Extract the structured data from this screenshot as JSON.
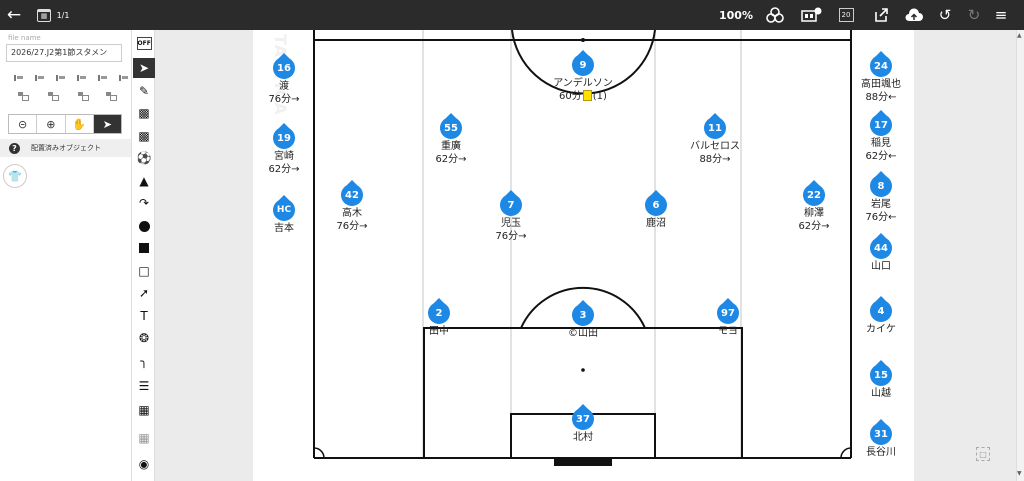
{
  "toolbar_top": {
    "page_count": "1/1",
    "zoom": "100%",
    "page_number_badge": "20",
    "icons": [
      "back-icon",
      "calendar-icon",
      "layers-icon",
      "settings-board-icon",
      "page-number-icon",
      "share-icon",
      "cloud-upload-icon",
      "undo-icon",
      "redo-icon",
      "menu-icon"
    ]
  },
  "left_panel": {
    "file_name_label": "file name",
    "file_name_value": "2026/27.J2第1節スタメン",
    "placed_objects_label": "配置済みオブジェクト"
  },
  "colors": {
    "player_marker": "#1e88e5",
    "yellow_card": "#ffe000",
    "topbar": "#2b2b2b"
  },
  "players": {
    "p16": {
      "number": "16",
      "name": "渡",
      "sub": "76分→"
    },
    "p19": {
      "number": "19",
      "name": "宮崎",
      "sub": "62分→"
    },
    "phc": {
      "number": "HC",
      "name": "吉本"
    },
    "p9": {
      "number": "9",
      "name": "アンデルソン",
      "sub_before": "60分",
      "sub_after": "(1)"
    },
    "p55": {
      "number": "55",
      "name": "重廣",
      "sub": "62分→"
    },
    "p11": {
      "number": "11",
      "name": "バルセロス",
      "sub": "88分→"
    },
    "p42": {
      "number": "42",
      "name": "高木",
      "sub": "76分→"
    },
    "p7": {
      "number": "7",
      "name": "児玉",
      "sub": "76分→"
    },
    "p6": {
      "number": "6",
      "name": "鹿沼"
    },
    "p22": {
      "number": "22",
      "name": "柳澤",
      "sub": "62分→"
    },
    "p2": {
      "number": "2",
      "name": "田中"
    },
    "p3": {
      "number": "3",
      "name": "©山田"
    },
    "p97": {
      "number": "97",
      "name": "モヨ"
    },
    "p37": {
      "number": "37",
      "name": "北村"
    },
    "p24": {
      "number": "24",
      "name": "高田颯也",
      "sub": "88分←"
    },
    "p17": {
      "number": "17",
      "name": "稲見",
      "sub": "62分←"
    },
    "p8": {
      "number": "8",
      "name": "岩尾",
      "sub": "76分←"
    },
    "p44": {
      "number": "44",
      "name": "山口"
    },
    "p4": {
      "number": "4",
      "name": "カイケ"
    },
    "p15": {
      "number": "15",
      "name": "山越"
    },
    "p31": {
      "number": "31",
      "name": "長谷川"
    }
  }
}
